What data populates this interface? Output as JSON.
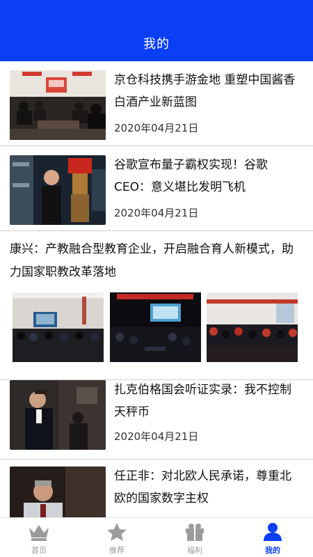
{
  "header": {
    "title": "我的"
  },
  "feed": {
    "items": [
      {
        "title": "京仓科技携手游金地 重塑中国酱香白酒产业新蓝图",
        "date": "2020年04月21日"
      },
      {
        "title": "谷歌宣布量子霸权实现！谷歌CEO：意义堪比发明飞机",
        "date": "2020年04月21日"
      },
      {
        "title": "康兴：产教融合型教育企业，开启融合育人新模式，助力国家职教改革落地"
      },
      {
        "title": "扎克伯格国会听证实录：我不控制天秤币",
        "date": "2020年04月21日"
      },
      {
        "title": "任正非：对北欧人民承诺，尊重北欧的国家数字主权"
      }
    ]
  },
  "tabbar": {
    "tabs": [
      {
        "label": "首页",
        "icon": "crown-icon"
      },
      {
        "label": "推荐",
        "icon": "star-icon"
      },
      {
        "label": "福利",
        "icon": "gift-icon"
      },
      {
        "label": "我的",
        "icon": "user-icon",
        "active": true
      }
    ]
  },
  "colors": {
    "accent": "#0a3ff5",
    "inactive": "#9b9b9b"
  }
}
